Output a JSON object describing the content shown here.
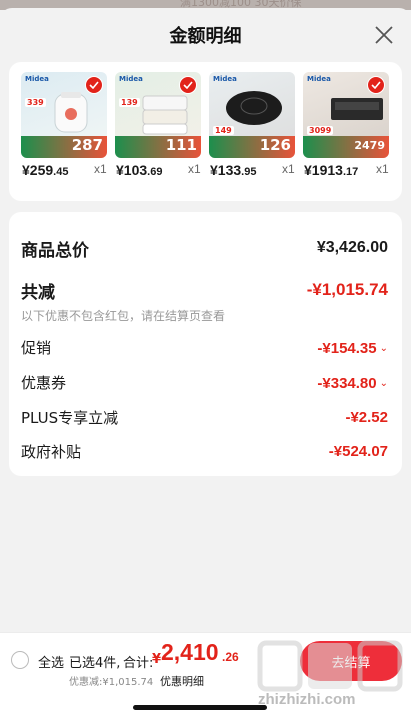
{
  "sheet": {
    "title": "金额明细"
  },
  "products": [
    {
      "price_int": "¥259",
      "price_dec": ".45",
      "qty": "x1",
      "thumb_label": "287",
      "thumb_tag": "339"
    },
    {
      "price_int": "¥103",
      "price_dec": ".69",
      "qty": "x1",
      "thumb_label": "111",
      "thumb_tag": "139"
    },
    {
      "price_int": "¥133",
      "price_dec": ".95",
      "qty": "x1",
      "thumb_label": "126",
      "thumb_tag": "149"
    },
    {
      "price_int": "¥1913",
      "price_dec": ".17",
      "qty": "x1",
      "thumb_label": "2479",
      "thumb_tag": "3099"
    }
  ],
  "summary": {
    "total_label": "商品总价",
    "total_value": "¥3,426.00",
    "reduce_label": "共减",
    "reduce_value": "-¥1,015.74",
    "note": "以下优惠不包含红包，请在结算页查看",
    "promo_label": "促销",
    "promo_value": "-¥154.35",
    "coupon_label": "优惠券",
    "coupon_value": "-¥334.80",
    "plus_label": "PLUS专享立减",
    "plus_value": "-¥2.52",
    "gov_label": "政府补贴",
    "gov_value": "-¥524.07"
  },
  "bottom": {
    "select_all": "全选",
    "selected_count": "已选4件,",
    "total_label": "合计:",
    "total_yen": "¥",
    "total_int": "2,410",
    "total_dec": ".26",
    "discount_line": "优惠减:¥1,015.74",
    "detail_link": "优惠明细",
    "checkout": "去结算",
    "watermark_url": "zhizhizhi.com"
  },
  "colors": {
    "accent": "#e2231a",
    "checkout": "#ee2e3a"
  }
}
